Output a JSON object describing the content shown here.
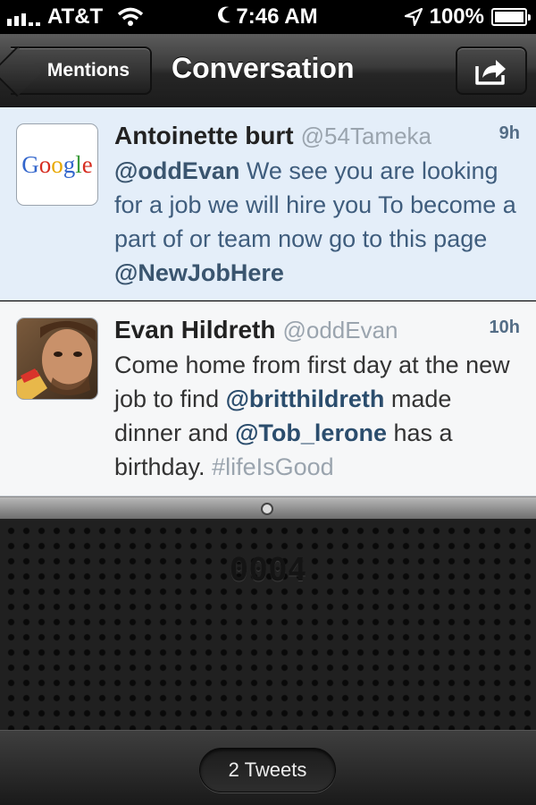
{
  "status_bar": {
    "carrier": "AT&T",
    "time": "7:46 AM",
    "battery": "100%",
    "battery_level": 1.0
  },
  "nav": {
    "back_label": "Mentions",
    "title": "Conversation",
    "share_icon": "share-icon"
  },
  "tweets": [
    {
      "name": "Antoinette burt",
      "handle": "@54Tameka",
      "time": "9h",
      "avatar_text": "Google",
      "parts": [
        "@oddEvan",
        " We see you are looking for a job we will hire you To become a part of or team now go to this page ",
        "@NewJobHere"
      ]
    },
    {
      "name": "Evan Hildreth",
      "handle": "@oddEvan",
      "time": "10h",
      "parts": [
        "Come home from first day at the new job to find ",
        "@britthildreth",
        " made dinner and ",
        "@Tob_lerone",
        " has a birthday. ",
        "#lifeIsGood"
      ]
    }
  ],
  "speaker": {
    "count": "0004"
  },
  "footer": {
    "tweet_count_label": "2 Tweets"
  }
}
